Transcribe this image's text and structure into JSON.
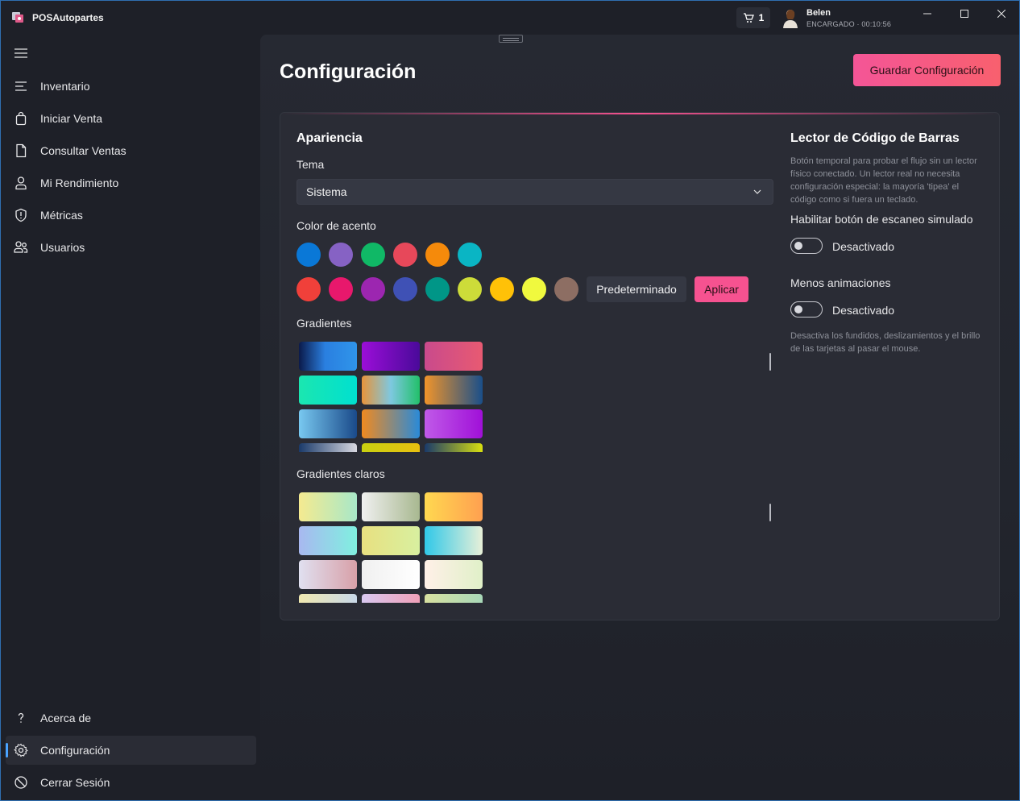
{
  "app": {
    "title": "POSAutopartes"
  },
  "titlebar": {
    "cart_count": "1",
    "user": {
      "name": "Belen",
      "role": "ENCARGADO",
      "session_time": "00:10:56"
    }
  },
  "sidebar": {
    "items": [
      {
        "label": "Inventario",
        "icon": "list-icon"
      },
      {
        "label": "Iniciar Venta",
        "icon": "shopping-bag-icon"
      },
      {
        "label": "Consultar Ventas",
        "icon": "document-icon"
      },
      {
        "label": "Mi Rendimiento",
        "icon": "person-icon"
      },
      {
        "label": "Métricas",
        "icon": "shield-icon"
      },
      {
        "label": "Usuarios",
        "icon": "people-icon"
      }
    ],
    "footer_items": [
      {
        "label": "Acerca de",
        "icon": "question-icon"
      },
      {
        "label": "Configuración",
        "icon": "gear-icon",
        "active": true
      },
      {
        "label": "Cerrar Sesión",
        "icon": "logout-icon"
      }
    ]
  },
  "main": {
    "title": "Configuración",
    "save_button": "Guardar Configuración",
    "appearance": {
      "heading": "Apariencia",
      "theme_label": "Tema",
      "theme_value": "Sistema",
      "accent_label": "Color de acento",
      "accent_colors_row1": [
        "#0a78d7",
        "#8662c4",
        "#10b866",
        "#e7485a",
        "#f58a0b",
        "#0ab5c4"
      ],
      "accent_colors_row2": [
        "#f0403a",
        "#e8186c",
        "#9c26b0",
        "#3f51b5",
        "#009687",
        "#cddc39",
        "#ffc107",
        "#f0f93e",
        "#8d6e63"
      ],
      "default_button": "Predeterminado",
      "apply_button": "Aplicar",
      "gradients_label": "Gradientes",
      "light_gradients_label": "Gradientes claros"
    },
    "barcode": {
      "heading": "Lector de Código de Barras",
      "description": "Botón temporal para probar el flujo sin un lector físico conectado. Un lector real no necesita configuración especial: la mayoría 'tipea' el código como si fuera un teclado.",
      "simulated_label": "Habilitar botón de escaneo simulado",
      "simulated_state": "Desactivado",
      "animations_label": "Menos animaciones",
      "animations_state": "Desactivado",
      "animations_description": "Desactiva los fundidos, deslizamientos y el brillo de las tarjetas al pasar el mouse."
    }
  },
  "colors": {
    "accent_pink": "#f65290",
    "active_indicator": "#4aa3ff",
    "background": "#1e2028",
    "card": "#2a2c35"
  }
}
